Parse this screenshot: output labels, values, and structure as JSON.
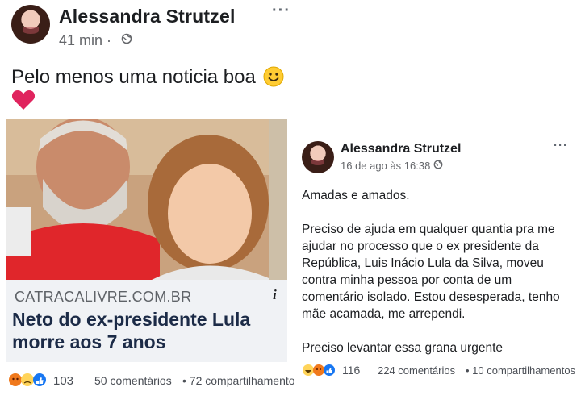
{
  "left_post": {
    "author": "Alessandra Strutzel",
    "time": "41 min ·",
    "privacy_icon": "globe-icon",
    "more": "···",
    "text": "Pelo menos uma noticia boa",
    "emojis": [
      "smile-emoji",
      "red-heart-emoji"
    ],
    "link": {
      "domain": "CATRACALIVRE.COM.BR",
      "title": "Neto do ex-presidente Lula morre aos 7 anos",
      "info_label": "i"
    },
    "reactions": [
      "angry",
      "sad",
      "like"
    ],
    "reaction_count": "103",
    "comments": "50 comentários",
    "shares": "• 72 compartilhamento"
  },
  "right_post": {
    "author": "Alessandra Strutzel",
    "time": "16 de ago às 16:38 ·",
    "privacy_icon": "globe-icon",
    "more": "···",
    "paragraphs": [
      "Amadas e amados.",
      "Preciso de ajuda em qualquer quantia pra me ajudar no processo que o ex presidente da República, Luis Inácio Lula da Silva, moveu contra minha pessoa por conta de um comentário isolado. Estou desesperada, tenho mãe acamada, me arrependi.",
      "Preciso levantar essa grana urgente"
    ],
    "reactions": [
      "haha",
      "angry",
      "like"
    ],
    "reaction_count": "116",
    "comments": "224 comentários",
    "shares": "• 10 compartilhamentos"
  },
  "colors": {
    "name": "#1c1e21",
    "meta": "#65676b",
    "link_title": "#1c2b47",
    "card_bg": "#f0f2f5",
    "like_blue": "#1877f2",
    "angry_red": "#e9710f",
    "heart_red": "#e0245e"
  }
}
